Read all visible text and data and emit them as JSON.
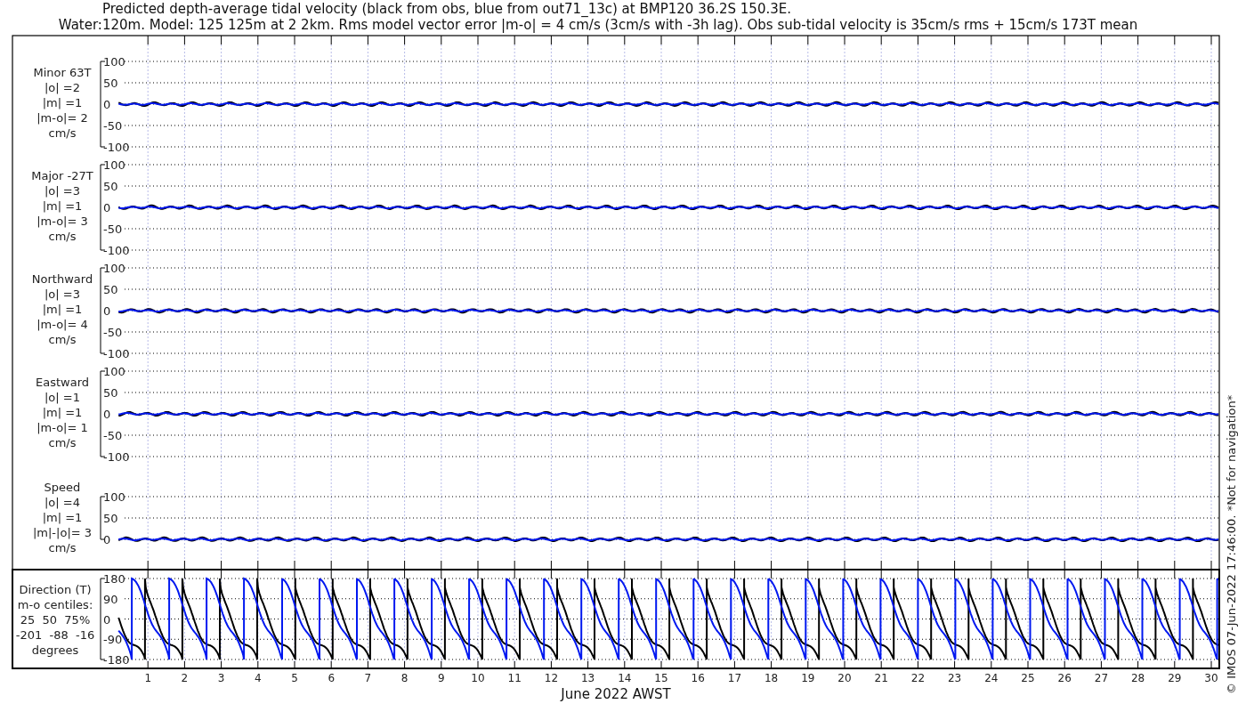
{
  "title_lines": [
    "Predicted depth-average tidal velocity (black from obs, blue from out71_13c) at BMP120 36.2S 150.3E.",
    "Water:120m. Model: 125 125m at 2 2km. Rms model vector error |m-o| = 4 cm/s (3cm/s with -3h lag). Obs sub-tidal velocity is 35cm/s rms + 15cm/s 173T mean"
  ],
  "panels": [
    {
      "label_lines": [
        "Minor 63T",
        "|o| =2",
        "|m| =1",
        "|m-o|= 2",
        "cm/s"
      ],
      "yticks": [
        "100",
        "50",
        "0",
        "-50",
        "-100"
      ]
    },
    {
      "label_lines": [
        "Major -27T",
        "|o| =3",
        "|m| =1",
        "|m-o|= 3",
        "cm/s"
      ],
      "yticks": [
        "100",
        "50",
        "0",
        "-50",
        "-100"
      ]
    },
    {
      "label_lines": [
        "Northward",
        "|o| =3",
        "|m| =1",
        "|m-o|= 4",
        "cm/s"
      ],
      "yticks": [
        "100",
        "50",
        "0",
        "-50",
        "-100"
      ]
    },
    {
      "label_lines": [
        "Eastward",
        "|o| =1",
        "|m| =1",
        "|m-o|= 1",
        "cm/s"
      ],
      "yticks": [
        "100",
        "50",
        "0",
        "-50",
        "-100"
      ]
    },
    {
      "label_lines": [
        "Speed",
        "|o| =4",
        "|m| =1",
        "|m|-|o|= 3",
        "cm/s"
      ],
      "yticks": [
        "100",
        "50",
        "0"
      ]
    }
  ],
  "direction_panel": {
    "label_lines": [
      "Direction (T)",
      "m-o centiles:",
      "25  50  75%",
      "-201  -88  -16",
      "degrees"
    ],
    "yticks": [
      "180",
      "90",
      "0",
      "-90",
      "-180"
    ]
  },
  "x_ticks": [
    "1",
    "2",
    "3",
    "4",
    "5",
    "6",
    "7",
    "8",
    "9",
    "10",
    "11",
    "12",
    "13",
    "14",
    "15",
    "16",
    "17",
    "18",
    "19",
    "20",
    "21",
    "22",
    "23",
    "24",
    "25",
    "26",
    "27",
    "28",
    "29",
    "30"
  ],
  "xlabel": "June 2022 AWST",
  "credit": "© IMOS 07-Jun-2022 17:46:00. *Not for navigation*"
}
